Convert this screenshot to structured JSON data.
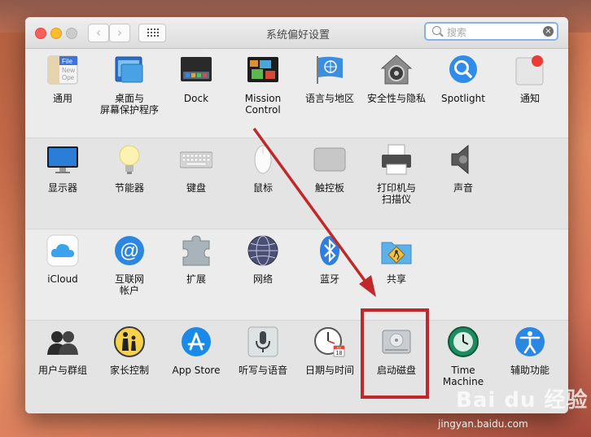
{
  "window": {
    "title": "系统偏好设置",
    "search_placeholder": "搜索"
  },
  "rows": [
    [
      {
        "name": "general",
        "label": "通用"
      },
      {
        "name": "desktop",
        "label": "桌面与\n屏幕保护程序"
      },
      {
        "name": "dock",
        "label": "Dock"
      },
      {
        "name": "mission-control",
        "label": "Mission\nControl"
      },
      {
        "name": "language-region",
        "label": "语言与地区"
      },
      {
        "name": "security",
        "label": "安全性与隐私"
      },
      {
        "name": "spotlight",
        "label": "Spotlight"
      },
      {
        "name": "notifications",
        "label": "通知"
      }
    ],
    [
      {
        "name": "displays",
        "label": "显示器"
      },
      {
        "name": "energy-saver",
        "label": "节能器"
      },
      {
        "name": "keyboard",
        "label": "键盘"
      },
      {
        "name": "mouse",
        "label": "鼠标"
      },
      {
        "name": "trackpad",
        "label": "触控板"
      },
      {
        "name": "printers",
        "label": "打印机与\n扫描仪"
      },
      {
        "name": "sound",
        "label": "声音"
      }
    ],
    [
      {
        "name": "icloud",
        "label": "iCloud"
      },
      {
        "name": "internet-accounts",
        "label": "互联网\n帐户"
      },
      {
        "name": "extensions",
        "label": "扩展"
      },
      {
        "name": "network",
        "label": "网络"
      },
      {
        "name": "bluetooth",
        "label": "蓝牙"
      },
      {
        "name": "sharing",
        "label": "共享"
      }
    ],
    [
      {
        "name": "users-groups",
        "label": "用户与群组"
      },
      {
        "name": "parental-controls",
        "label": "家长控制"
      },
      {
        "name": "app-store",
        "label": "App Store"
      },
      {
        "name": "dictation",
        "label": "听写与语音"
      },
      {
        "name": "date-time",
        "label": "日期与时间"
      },
      {
        "name": "startup-disk",
        "label": "启动磁盘"
      },
      {
        "name": "time-machine",
        "label": "Time Machine"
      },
      {
        "name": "accessibility",
        "label": "辅助功能"
      }
    ]
  ],
  "general_icon_text": [
    "File",
    "New",
    "Ope"
  ],
  "calendar_icon_text": [
    "JUL",
    "18"
  ],
  "watermark": {
    "brand": "Bai du 经验",
    "url": "jingyan.baidu.com"
  },
  "colors": {
    "annotation": "#c0282a",
    "search_focus": "#86b1ec"
  }
}
